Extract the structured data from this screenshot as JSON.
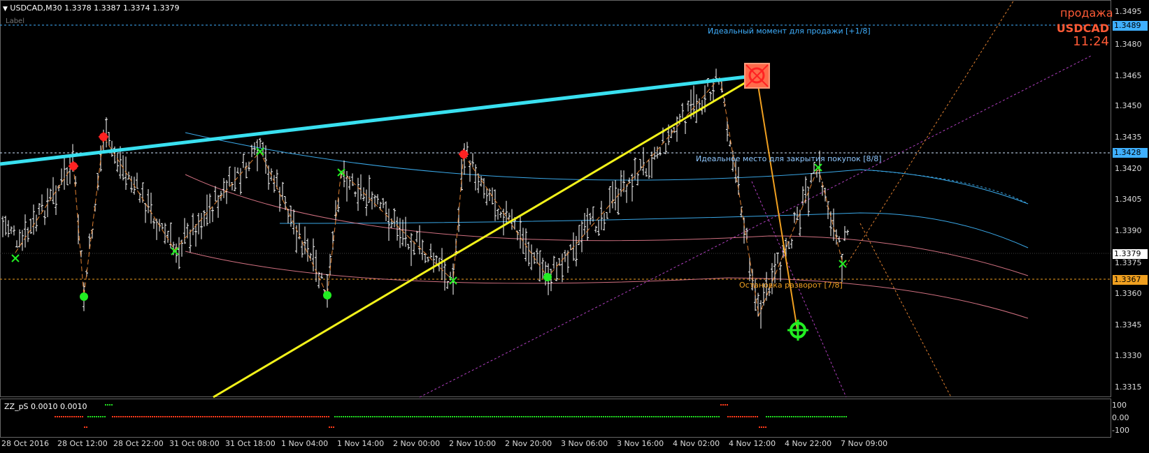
{
  "header": {
    "symbol_info": "USDCAD,M30  1.3378 1.3387 1.3374 1.3379",
    "menu_icon": "dropdown-triangle-icon",
    "sublabel": "Label"
  },
  "signal": {
    "action": "продажа",
    "symbol": "USDCAD",
    "time": "11:24",
    "color": "#ff5a36"
  },
  "annotations": {
    "sell_moment": "Идеальный момент для продажи [+1/8]",
    "close_buys": "Идеальное место для закрытия покупок [8/8]",
    "stop_reversal": "Остановка разворот [7/8]"
  },
  "price_axis": {
    "ticks": [
      "1.3495",
      "1.3480",
      "1.3465",
      "1.3450",
      "1.3435",
      "1.3420",
      "1.3405",
      "1.3390",
      "1.3375",
      "1.3360",
      "1.3345",
      "1.3330",
      "1.3315"
    ],
    "tags": [
      {
        "value": "1.3489",
        "color": "#3fb0ff",
        "text_color": "#000"
      },
      {
        "value": "1.3428",
        "color": "#3fb0ff",
        "text_color": "#000"
      },
      {
        "value": "1.3379",
        "color": "#ffffff",
        "text_color": "#000"
      },
      {
        "value": "1.3367",
        "color": "#f0a020",
        "text_color": "#000"
      }
    ]
  },
  "time_axis": {
    "ticks": [
      "28 Oct 2016",
      "28 Oct 12:00",
      "28 Oct 22:00",
      "31 Oct 08:00",
      "31 Oct 18:00",
      "1 Nov 04:00",
      "1 Nov 14:00",
      "2 Nov 00:00",
      "2 Nov 10:00",
      "2 Nov 20:00",
      "3 Nov 06:00",
      "3 Nov 16:00",
      "4 Nov 02:00",
      "4 Nov 12:00",
      "4 Nov 22:00",
      "7 Nov 09:00"
    ]
  },
  "oscillator": {
    "title": "ZZ_pS 0.0010 0.0010",
    "ticks": [
      "100",
      "0.00",
      "-100"
    ]
  },
  "colors": {
    "background": "#000000",
    "candles": "#ffffff",
    "trend_line_cyan": "#39e0f0",
    "trend_line_yellow": "#f2f21a",
    "level_cyan": "#3fb0ff",
    "level_orange": "#f0a020",
    "arc_blue": "#3aa8e8",
    "arc_pink": "#d07080",
    "zigzag": "#e08030",
    "marker_buy": "#22ee22",
    "marker_sell": "#ff2222",
    "osc_red": "#ff3a1a",
    "osc_green": "#22dd22"
  }
}
